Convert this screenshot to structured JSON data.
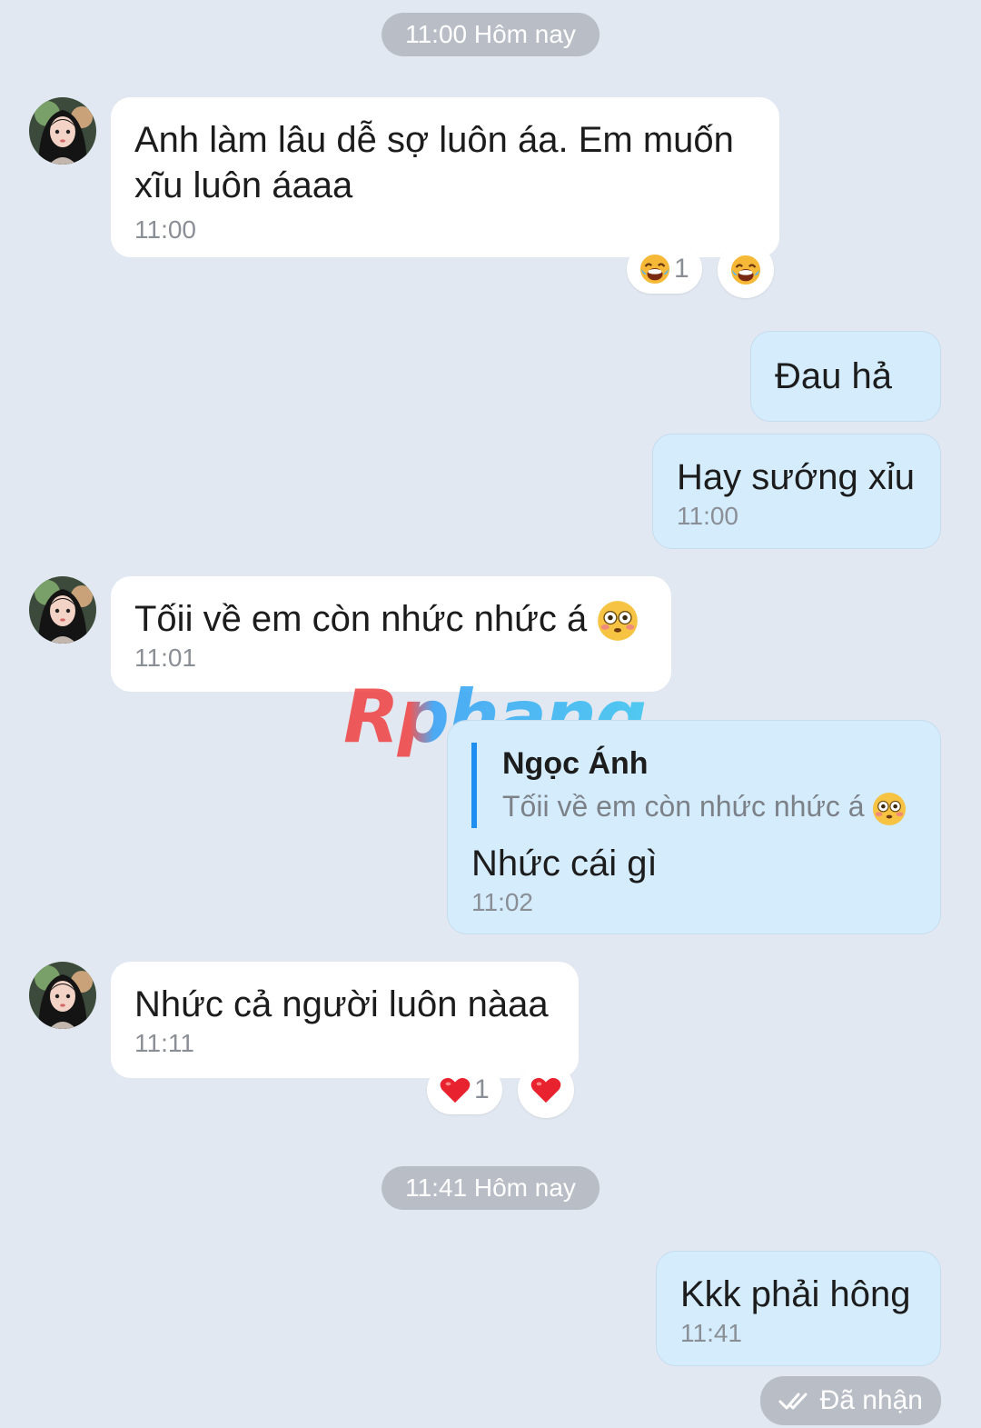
{
  "separators": [
    "11:00 Hôm nay",
    "11:41 Hôm nay"
  ],
  "messages": [
    {
      "direction": "in",
      "text": "Anh làm lâu dễ sợ luôn áa. Em muốn xĩu luôn áaaa",
      "time": "11:00",
      "reaction": {
        "emoji": "laughing-crying",
        "count": "1"
      }
    },
    {
      "direction": "out",
      "text": "Đau hả"
    },
    {
      "direction": "out",
      "text": "Hay sướng xỉu",
      "time": "11:00"
    },
    {
      "direction": "in",
      "text": "Tốii về em còn nhức nhức á",
      "time": "11:01",
      "emoji": "flushed-face"
    },
    {
      "direction": "out",
      "quote": {
        "name": "Ngọc Ánh",
        "text": "Tốii về em còn nhức nhức á"
      },
      "text": "Nhức cái gì",
      "time": "11:02"
    },
    {
      "direction": "in",
      "text": "Nhức cả người luôn nàaa",
      "time": "11:11",
      "reaction": {
        "emoji": "heart",
        "count": "1"
      }
    },
    {
      "direction": "out",
      "text": "Kkk phải hông",
      "time": "11:41"
    }
  ],
  "status": "Đã nhận",
  "watermark": "Rphang",
  "colors": {
    "background": "#e2e8f1",
    "incoming": "#ffffff",
    "outgoing": "#d5ecfd",
    "accent": "#1f8ef1"
  }
}
